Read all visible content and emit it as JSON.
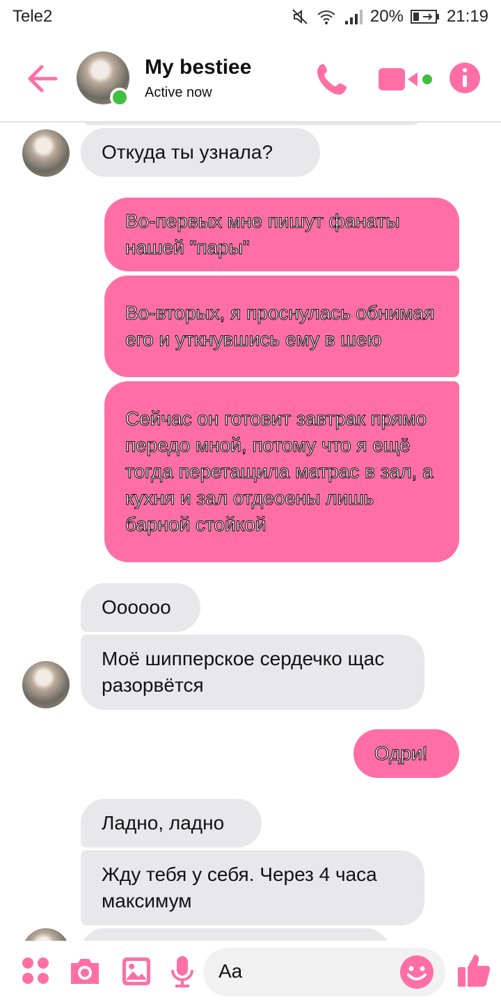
{
  "status_bar": {
    "carrier": "Tele2",
    "battery": "20%",
    "time": "21:19"
  },
  "header": {
    "contact_name": "My bestiee",
    "contact_status": "Active now",
    "accent_color": "#ff6fa5",
    "online_color": "#3fbf3f"
  },
  "messages": [
    {
      "direction": "in",
      "text": "Откуда ты узнала?"
    },
    {
      "direction": "out",
      "text": "Во-первых мне пишут фанаты нашей \"пары\""
    },
    {
      "direction": "out",
      "text": "Во-вторых, я проснулась обнимая его и уткнувшись ему в шею"
    },
    {
      "direction": "out",
      "text": "Сейчас он готовит завтрак прямо передо мной, потому что я ещё тогда перетащила матрас в зал, а кухня и зал отдеоены лишь барной стойкой"
    },
    {
      "direction": "in",
      "text": "Оооооо"
    },
    {
      "direction": "in",
      "text": "Моё шипперское сердечко щас разорвётся"
    },
    {
      "direction": "out",
      "text": "Одри!"
    },
    {
      "direction": "in",
      "text": "Ладно, ладно"
    },
    {
      "direction": "in",
      "text": "Жду тебя у себя. Через 4 часа максимум"
    }
  ],
  "composer": {
    "input_placeholder": "Aa",
    "icons": [
      "apps-icon",
      "camera-icon",
      "gallery-icon",
      "microphone-icon",
      "emoji-icon",
      "thumbs-up-icon"
    ]
  }
}
